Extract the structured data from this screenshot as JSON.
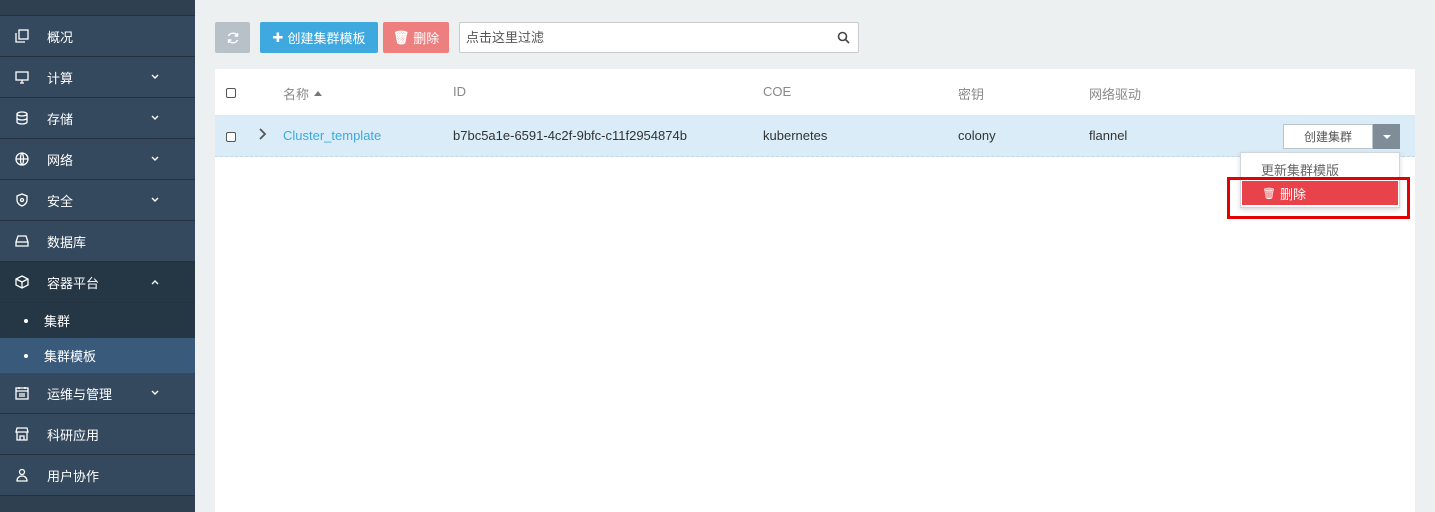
{
  "sidebar": {
    "items": [
      {
        "label": "概况",
        "icon": "overview-icon"
      },
      {
        "label": "计算",
        "icon": "monitor-icon"
      },
      {
        "label": "存储",
        "icon": "database-icon"
      },
      {
        "label": "网络",
        "icon": "globe-icon"
      },
      {
        "label": "安全",
        "icon": "shield-icon"
      },
      {
        "label": "数据库",
        "icon": "hdd-icon"
      },
      {
        "label": "容器平台",
        "icon": "cube-icon"
      },
      {
        "label": "运维与管理",
        "icon": "calendar-icon"
      },
      {
        "label": "科研应用",
        "icon": "store-icon"
      },
      {
        "label": "用户协作",
        "icon": "users-icon"
      }
    ],
    "sub_items": [
      {
        "label": "集群"
      },
      {
        "label": "集群模板"
      }
    ]
  },
  "toolbar": {
    "create_label": "创建集群模板",
    "delete_label": "删除"
  },
  "search": {
    "placeholder": "点击这里过滤"
  },
  "table": {
    "headers": [
      "名称",
      "ID",
      "COE",
      "密钥",
      "网络驱动"
    ],
    "rows": [
      {
        "name": "Cluster_template",
        "id": "b7bc5a1e-6591-4c2f-9bfc-c11f2954874b",
        "coe": "kubernetes",
        "keypair": "colony",
        "network_driver": "flannel",
        "action_label": "创建集群"
      }
    ]
  },
  "dropdown": {
    "items": [
      {
        "label": "更新集群模版"
      },
      {
        "label": "删除"
      }
    ]
  },
  "colors": {
    "sidebar_bg": "#34495e",
    "active_sub": "#3a5a7c",
    "primary": "#3fa9df",
    "danger_light": "#ee7f7f",
    "danger": "#e8434a",
    "highlight_border": "#e30000"
  }
}
